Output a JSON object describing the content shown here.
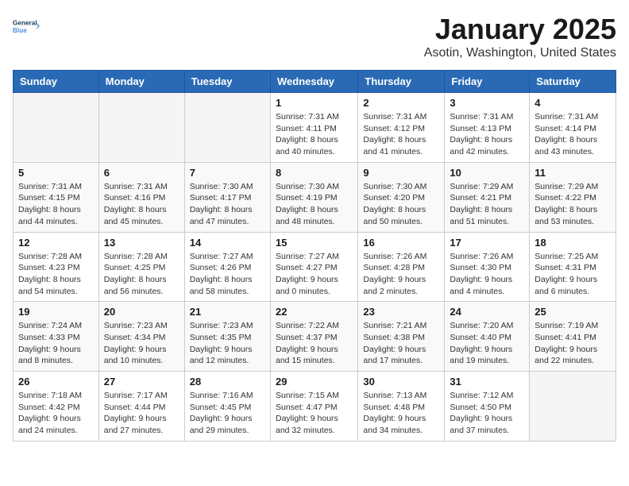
{
  "header": {
    "logo_line1": "General",
    "logo_line2": "Blue",
    "month": "January 2025",
    "location": "Asotin, Washington, United States"
  },
  "weekdays": [
    "Sunday",
    "Monday",
    "Tuesday",
    "Wednesday",
    "Thursday",
    "Friday",
    "Saturday"
  ],
  "weeks": [
    [
      {
        "day": "",
        "empty": true
      },
      {
        "day": "",
        "empty": true
      },
      {
        "day": "",
        "empty": true
      },
      {
        "day": "1",
        "sunrise": "7:31 AM",
        "sunset": "4:11 PM",
        "daylight": "8 hours and 40 minutes."
      },
      {
        "day": "2",
        "sunrise": "7:31 AM",
        "sunset": "4:12 PM",
        "daylight": "8 hours and 41 minutes."
      },
      {
        "day": "3",
        "sunrise": "7:31 AM",
        "sunset": "4:13 PM",
        "daylight": "8 hours and 42 minutes."
      },
      {
        "day": "4",
        "sunrise": "7:31 AM",
        "sunset": "4:14 PM",
        "daylight": "8 hours and 43 minutes."
      }
    ],
    [
      {
        "day": "5",
        "sunrise": "7:31 AM",
        "sunset": "4:15 PM",
        "daylight": "8 hours and 44 minutes."
      },
      {
        "day": "6",
        "sunrise": "7:31 AM",
        "sunset": "4:16 PM",
        "daylight": "8 hours and 45 minutes."
      },
      {
        "day": "7",
        "sunrise": "7:30 AM",
        "sunset": "4:17 PM",
        "daylight": "8 hours and 47 minutes."
      },
      {
        "day": "8",
        "sunrise": "7:30 AM",
        "sunset": "4:19 PM",
        "daylight": "8 hours and 48 minutes."
      },
      {
        "day": "9",
        "sunrise": "7:30 AM",
        "sunset": "4:20 PM",
        "daylight": "8 hours and 50 minutes."
      },
      {
        "day": "10",
        "sunrise": "7:29 AM",
        "sunset": "4:21 PM",
        "daylight": "8 hours and 51 minutes."
      },
      {
        "day": "11",
        "sunrise": "7:29 AM",
        "sunset": "4:22 PM",
        "daylight": "8 hours and 53 minutes."
      }
    ],
    [
      {
        "day": "12",
        "sunrise": "7:28 AM",
        "sunset": "4:23 PM",
        "daylight": "8 hours and 54 minutes."
      },
      {
        "day": "13",
        "sunrise": "7:28 AM",
        "sunset": "4:25 PM",
        "daylight": "8 hours and 56 minutes."
      },
      {
        "day": "14",
        "sunrise": "7:27 AM",
        "sunset": "4:26 PM",
        "daylight": "8 hours and 58 minutes."
      },
      {
        "day": "15",
        "sunrise": "7:27 AM",
        "sunset": "4:27 PM",
        "daylight": "9 hours and 0 minutes."
      },
      {
        "day": "16",
        "sunrise": "7:26 AM",
        "sunset": "4:28 PM",
        "daylight": "9 hours and 2 minutes."
      },
      {
        "day": "17",
        "sunrise": "7:26 AM",
        "sunset": "4:30 PM",
        "daylight": "9 hours and 4 minutes."
      },
      {
        "day": "18",
        "sunrise": "7:25 AM",
        "sunset": "4:31 PM",
        "daylight": "9 hours and 6 minutes."
      }
    ],
    [
      {
        "day": "19",
        "sunrise": "7:24 AM",
        "sunset": "4:33 PM",
        "daylight": "9 hours and 8 minutes."
      },
      {
        "day": "20",
        "sunrise": "7:23 AM",
        "sunset": "4:34 PM",
        "daylight": "9 hours and 10 minutes."
      },
      {
        "day": "21",
        "sunrise": "7:23 AM",
        "sunset": "4:35 PM",
        "daylight": "9 hours and 12 minutes."
      },
      {
        "day": "22",
        "sunrise": "7:22 AM",
        "sunset": "4:37 PM",
        "daylight": "9 hours and 15 minutes."
      },
      {
        "day": "23",
        "sunrise": "7:21 AM",
        "sunset": "4:38 PM",
        "daylight": "9 hours and 17 minutes."
      },
      {
        "day": "24",
        "sunrise": "7:20 AM",
        "sunset": "4:40 PM",
        "daylight": "9 hours and 19 minutes."
      },
      {
        "day": "25",
        "sunrise": "7:19 AM",
        "sunset": "4:41 PM",
        "daylight": "9 hours and 22 minutes."
      }
    ],
    [
      {
        "day": "26",
        "sunrise": "7:18 AM",
        "sunset": "4:42 PM",
        "daylight": "9 hours and 24 minutes."
      },
      {
        "day": "27",
        "sunrise": "7:17 AM",
        "sunset": "4:44 PM",
        "daylight": "9 hours and 27 minutes."
      },
      {
        "day": "28",
        "sunrise": "7:16 AM",
        "sunset": "4:45 PM",
        "daylight": "9 hours and 29 minutes."
      },
      {
        "day": "29",
        "sunrise": "7:15 AM",
        "sunset": "4:47 PM",
        "daylight": "9 hours and 32 minutes."
      },
      {
        "day": "30",
        "sunrise": "7:13 AM",
        "sunset": "4:48 PM",
        "daylight": "9 hours and 34 minutes."
      },
      {
        "day": "31",
        "sunrise": "7:12 AM",
        "sunset": "4:50 PM",
        "daylight": "9 hours and 37 minutes."
      },
      {
        "day": "",
        "empty": true
      }
    ]
  ],
  "labels": {
    "sunrise_prefix": "Sunrise: ",
    "sunset_prefix": "Sunset: ",
    "daylight_prefix": "Daylight: "
  }
}
